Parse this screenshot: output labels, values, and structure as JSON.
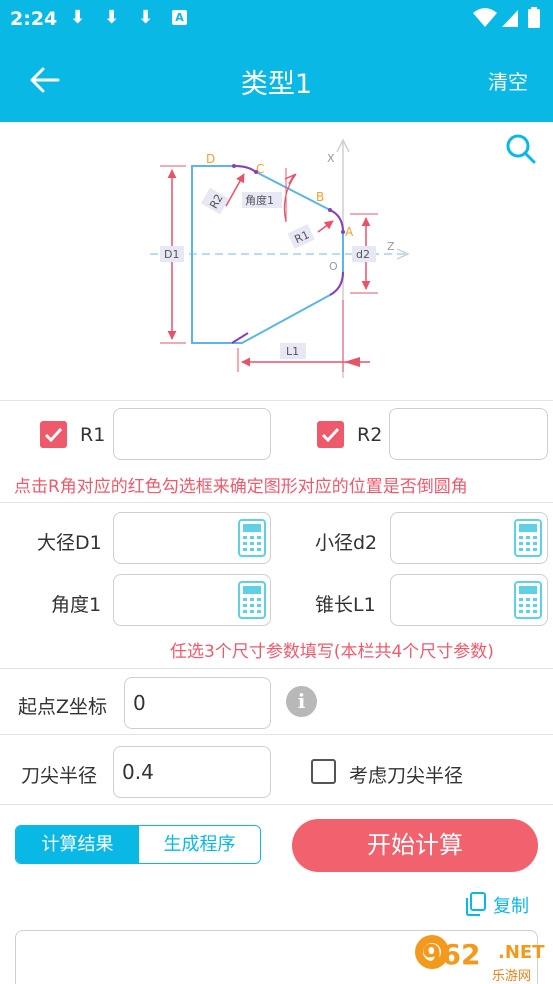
{
  "status_bar": {
    "time": "2:24",
    "download_glyph": "⬇",
    "a_badge": "A"
  },
  "app_bar": {
    "title": "类型1",
    "clear": "清空"
  },
  "diagram": {
    "labels": {
      "D": "D",
      "C": "C",
      "B": "B",
      "A": "A",
      "O": "O",
      "X": "X",
      "Z": "Z",
      "R2": "R2",
      "R1": "R1",
      "angle": "角度1",
      "D1": "D1",
      "d2": "d2",
      "L1": "L1"
    }
  },
  "fillet": {
    "r1": {
      "label": "R1",
      "value": "",
      "checked": true
    },
    "r2": {
      "label": "R2",
      "value": "",
      "checked": true
    },
    "note": "点击R角对应的红色勾选框来确定图形对应的位置是否倒圆角"
  },
  "dims": {
    "d1": {
      "label": "大径D1",
      "value": ""
    },
    "d2": {
      "label": "小径d2",
      "value": ""
    },
    "angle": {
      "label": "角度1",
      "value": ""
    },
    "l1": {
      "label": "锥长L1",
      "value": ""
    },
    "note": "任选3个尺寸参数填写(本栏共4个尺寸参数)"
  },
  "start_z": {
    "label": "起点Z坐标",
    "value": "0"
  },
  "tool_radius": {
    "label": "刀尖半径",
    "value": "0.4",
    "consider_label": "考虑刀尖半径",
    "consider_checked": false
  },
  "tabs": {
    "result": "计算结果",
    "program": "生成程序"
  },
  "start_button": "开始计算",
  "copy_label": "复制",
  "watermark": {
    "brand": "962",
    "tld": ".NET",
    "sub": "乐游网"
  },
  "colors": {
    "accent": "#0ab8e6",
    "danger": "#ee5a6c",
    "shape": "#5bb5e6",
    "dim": "#e8536a",
    "label_bg": "#e7e7f6"
  },
  "icons": [
    "back-arrow-icon",
    "search-icon",
    "calculator-icon",
    "info-icon",
    "copy-icon",
    "download-icon",
    "wifi-icon",
    "signal-icon",
    "battery-icon"
  ]
}
